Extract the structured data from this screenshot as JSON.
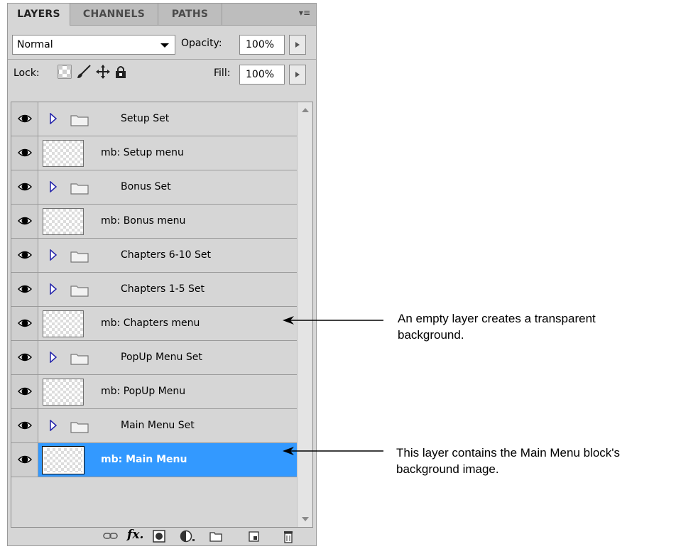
{
  "tabs": [
    "LAYERS",
    "CHANNELS",
    "PATHS"
  ],
  "blend_mode": "Normal",
  "opacity": {
    "label": "Opacity:",
    "value": "100%"
  },
  "lock": {
    "label": "Lock:"
  },
  "fill": {
    "label": "Fill:",
    "value": "100%"
  },
  "layers": [
    {
      "type": "set",
      "name": "Setup Set"
    },
    {
      "type": "layer",
      "name": "mb: Setup menu"
    },
    {
      "type": "set",
      "name": "Bonus Set"
    },
    {
      "type": "layer",
      "name": "mb: Bonus menu"
    },
    {
      "type": "set",
      "name": "Chapters 6-10 Set"
    },
    {
      "type": "set",
      "name": "Chapters 1-5 Set"
    },
    {
      "type": "layer",
      "name": "mb: Chapters menu"
    },
    {
      "type": "set",
      "name": "PopUp Menu Set"
    },
    {
      "type": "layer",
      "name": "mb: PopUp Menu"
    },
    {
      "type": "set",
      "name": "Main Menu Set"
    },
    {
      "type": "layer",
      "name": "mb: Main Menu",
      "selected": true
    }
  ],
  "annotations": {
    "empty_layer": "An empty layer creates a transparent background.",
    "main_menu": "This layer contains the Main Menu block's background image."
  },
  "colors": {
    "selection": "#3399ff",
    "panel": "#d6d6d6"
  },
  "bottom_icons": [
    "link-icon",
    "fx-icon",
    "mask-icon",
    "adjustment-icon",
    "folder-icon",
    "new-layer-icon",
    "trash-icon"
  ]
}
